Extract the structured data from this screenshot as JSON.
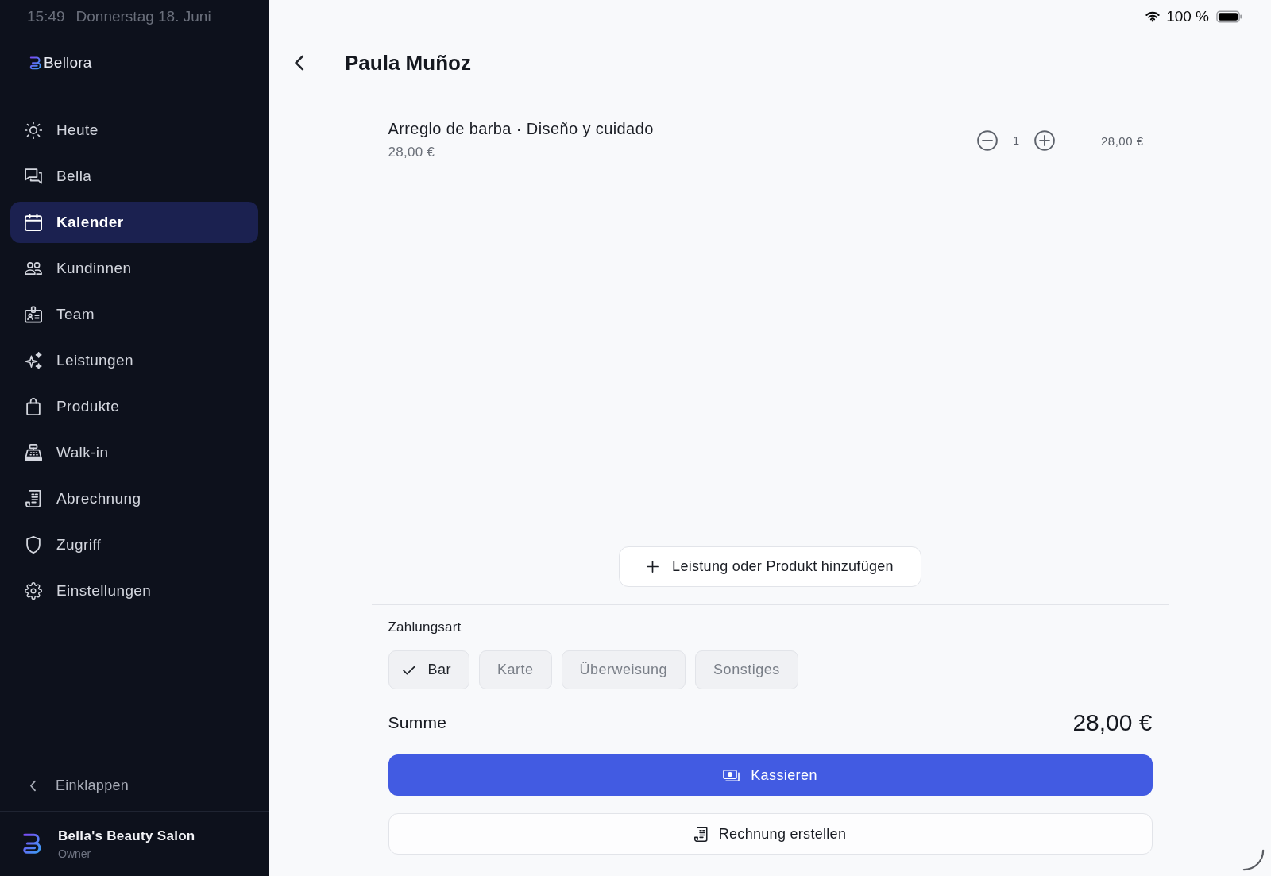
{
  "status_bar": {
    "time": "15:49",
    "date": "Donnerstag 18. Juni",
    "battery": "100 %"
  },
  "sidebar": {
    "brand": "Bellora",
    "items": [
      {
        "label": "Heute",
        "selected": false
      },
      {
        "label": "Bella",
        "selected": false
      },
      {
        "label": "Kalender",
        "selected": true
      },
      {
        "label": "Kundinnen",
        "selected": false
      },
      {
        "label": "Team",
        "selected": false
      },
      {
        "label": "Leistungen",
        "selected": false
      },
      {
        "label": "Produkte",
        "selected": false
      },
      {
        "label": "Walk-in",
        "selected": false
      },
      {
        "label": "Abrechnung",
        "selected": false
      },
      {
        "label": "Zugriff",
        "selected": false
      },
      {
        "label": "Einstellungen",
        "selected": false
      }
    ],
    "collapse": "Einklappen",
    "account": {
      "name": "Bella's Beauty Salon",
      "role": "Owner"
    }
  },
  "header": {
    "title": "Paula Muñoz"
  },
  "line_items": [
    {
      "name": "Arreglo de barba · Diseño y cuidado",
      "price": "28,00 €",
      "quantity": "1",
      "total": "28,00 €"
    }
  ],
  "add_button": "Leistung oder Produkt hinzufügen",
  "payment": {
    "label": "Zahlungsart",
    "methods": [
      {
        "label": "Bar",
        "selected": true
      },
      {
        "label": "Karte",
        "selected": false
      },
      {
        "label": "Überweisung",
        "selected": false
      },
      {
        "label": "Sonstiges",
        "selected": false
      }
    ]
  },
  "total": {
    "label": "Summe",
    "amount": "28,00 €"
  },
  "actions": {
    "checkout": "Kassieren",
    "invoice": "Rechnung erstellen"
  }
}
